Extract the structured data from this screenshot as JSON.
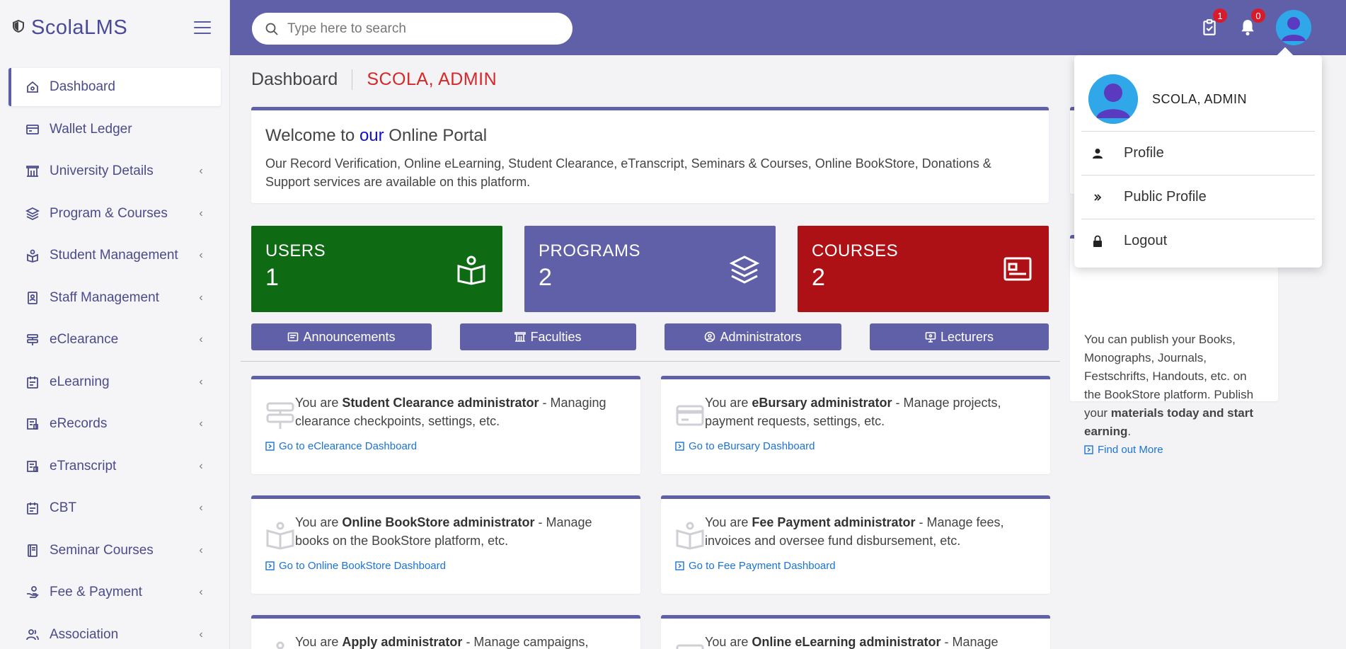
{
  "app": {
    "brand": "ScolaLMS"
  },
  "sidebar": {
    "items": [
      {
        "label": "Dashboard",
        "icon": "home-icon",
        "active": true
      },
      {
        "label": "Wallet Ledger",
        "icon": "card-icon"
      },
      {
        "label": "University Details",
        "icon": "building-icon"
      },
      {
        "label": "Program & Courses",
        "icon": "layers-icon"
      },
      {
        "label": "Student Management",
        "icon": "student-icon"
      },
      {
        "label": "Staff Management",
        "icon": "badge-icon"
      },
      {
        "label": "eClearance",
        "icon": "signpost-icon"
      },
      {
        "label": "eLearning",
        "icon": "calendar-icon"
      },
      {
        "label": "eRecords",
        "icon": "records-icon"
      },
      {
        "label": "eTranscript",
        "icon": "transcript-icon"
      },
      {
        "label": "CBT",
        "icon": "calendar-icon"
      },
      {
        "label": "Seminar Courses",
        "icon": "book-icon"
      },
      {
        "label": "Fee & Payment",
        "icon": "payment-icon"
      },
      {
        "label": "Association",
        "icon": "people-icon"
      }
    ]
  },
  "topbar": {
    "search_placeholder": "Type here to search",
    "tasks_badge": "1",
    "notifications_badge": "0"
  },
  "header": {
    "title": "Dashboard",
    "user": "SCOLA, ADMIN"
  },
  "welcome": {
    "title_prefix": "Welcome to ",
    "title_highlight": "our",
    "title_suffix": " Online Portal",
    "text": "Our Record Verification, Online eLearning, Student Clearance, eTranscript, Seminars & Courses, Online BookStore, Donations & Support services are available on this platform."
  },
  "stats": [
    {
      "label": "USERS",
      "value": "1",
      "color": "#0e6b14"
    },
    {
      "label": "PROGRAMS",
      "value": "2",
      "color": "#6060a8"
    },
    {
      "label": "COURSES",
      "value": "2",
      "color": "#ad1116"
    }
  ],
  "quick_buttons": [
    {
      "label": "Announcements"
    },
    {
      "label": "Faculties"
    },
    {
      "label": "Administrators"
    },
    {
      "label": "Lecturers"
    }
  ],
  "cards": [
    {
      "prefix": "You are ",
      "role": "Student Clearance administrator",
      "desc": " - Managing clearance checkpoints, settings, etc.",
      "link": "Go to eClearance Dashboard"
    },
    {
      "prefix": "You are ",
      "role": "eBursary administrator",
      "desc": " - Manage projects, payment requests, settings, etc.",
      "link": "Go to eBursary Dashboard"
    },
    {
      "prefix": "You are ",
      "role": "Online BookStore administrator",
      "desc": " - Manage books on the BookStore platform, etc.",
      "link": "Go to Online BookStore Dashboard"
    },
    {
      "prefix": "You are ",
      "role": "Fee Payment administrator",
      "desc": " - Manage fees, invoices and oversee fund disbursement, etc.",
      "link": "Go to Fee Payment Dashboard"
    },
    {
      "prefix": "You are ",
      "role": "Apply administrator",
      "desc": " - Manage campaigns,",
      "link": ""
    },
    {
      "prefix": "You are ",
      "role": "Online eLearning administrator",
      "desc": " - Manage",
      "link": ""
    }
  ],
  "publish": {
    "text_before": "You can publish your Books, Monographs, Journals, Festschrifts, Handouts, etc. on the BookStore platform. Publish your ",
    "text_bold": "materials today and start earning",
    "text_after": ".",
    "link": "Find out More"
  },
  "dropdown": {
    "name": "SCOLA, ADMIN",
    "items": [
      {
        "label": "Profile",
        "icon": "person-icon"
      },
      {
        "label": "Public Profile",
        "icon": "double-chevron-icon"
      },
      {
        "label": "Logout",
        "icon": "lock-icon"
      }
    ]
  }
}
